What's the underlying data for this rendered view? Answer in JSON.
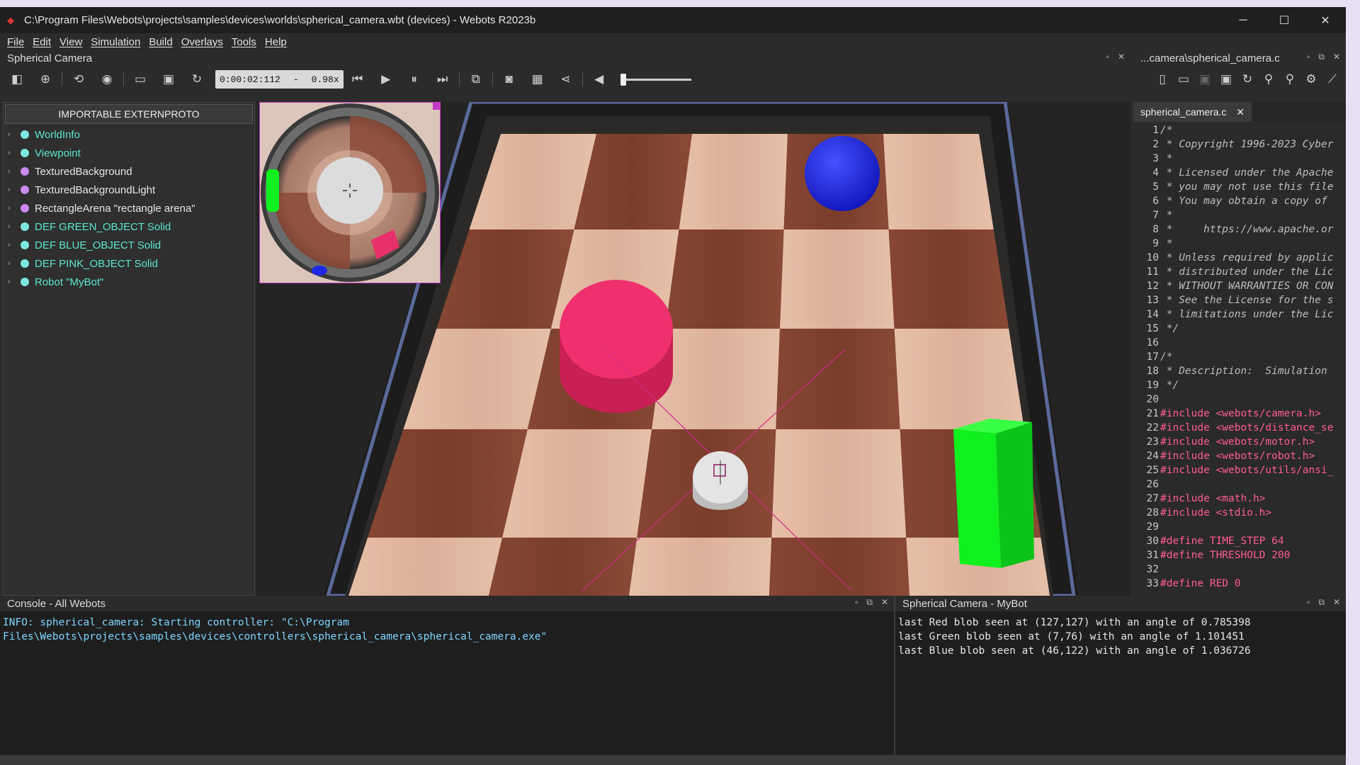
{
  "window": {
    "title": "C:\\Program Files\\Webots\\projects\\samples\\devices\\worlds\\spherical_camera.wbt (devices) - Webots R2023b",
    "minimize": "─",
    "maximize": "☐",
    "close": "✕"
  },
  "menu": [
    "File",
    "Edit",
    "View",
    "Simulation",
    "Build",
    "Overlays",
    "Tools",
    "Help"
  ],
  "scene_panel": {
    "title": "Spherical Camera",
    "time": "0:00:02:112",
    "speed_sep": "-",
    "speed": "0.98x",
    "extern_button": "IMPORTABLE EXTERNPROTO",
    "tree": [
      {
        "label": "WorldInfo",
        "color": "#5ce6d0",
        "dot": "#7ee8e0"
      },
      {
        "label": "Viewpoint",
        "color": "#5ce6d0",
        "dot": "#7ee8e0"
      },
      {
        "label": "TexturedBackground",
        "color": "#e6e6e6",
        "dot": "#c98bf0"
      },
      {
        "label": "TexturedBackgroundLight",
        "color": "#e6e6e6",
        "dot": "#c98bf0"
      },
      {
        "label": "RectangleArena \"rectangle arena\"",
        "color": "#e6e6e6",
        "dot": "#c98bf0"
      },
      {
        "label": "DEF GREEN_OBJECT Solid",
        "color": "#5ce6d0",
        "dot": "#7ee8e0"
      },
      {
        "label": "DEF BLUE_OBJECT Solid",
        "color": "#5ce6d0",
        "dot": "#7ee8e0"
      },
      {
        "label": "DEF PINK_OBJECT Solid",
        "color": "#5ce6d0",
        "dot": "#7ee8e0"
      },
      {
        "label": "Robot \"MyBot\"",
        "color": "#5ce6d0",
        "dot": "#7ee8e0"
      }
    ]
  },
  "editor": {
    "title": "...camera\\spherical_camera.c",
    "tab": "spherical_camera.c",
    "tab_close": "✕",
    "lines": [
      {
        "n": "1",
        "t": "/*",
        "k": "cm"
      },
      {
        "n": "2",
        "t": " * Copyright 1996-2023 Cyber",
        "k": "cm"
      },
      {
        "n": "3",
        "t": " *",
        "k": "cm"
      },
      {
        "n": "4",
        "t": " * Licensed under the Apache",
        "k": "cm"
      },
      {
        "n": "5",
        "t": " * you may not use this file",
        "k": "cm"
      },
      {
        "n": "6",
        "t": " * You may obtain a copy of",
        "k": "cm"
      },
      {
        "n": "7",
        "t": " *",
        "k": "cm"
      },
      {
        "n": "8",
        "t": " *     https://www.apache.or",
        "k": "cm"
      },
      {
        "n": "9",
        "t": " *",
        "k": "cm"
      },
      {
        "n": "10",
        "t": " * Unless required by applic",
        "k": "cm"
      },
      {
        "n": "11",
        "t": " * distributed under the Lic",
        "k": "cm"
      },
      {
        "n": "12",
        "t": " * WITHOUT WARRANTIES OR CON",
        "k": "cm"
      },
      {
        "n": "13",
        "t": " * See the License for the s",
        "k": "cm"
      },
      {
        "n": "14",
        "t": " * limitations under the Lic",
        "k": "cm"
      },
      {
        "n": "15",
        "t": " */",
        "k": "cm"
      },
      {
        "n": "16",
        "t": "",
        "k": "cm"
      },
      {
        "n": "17",
        "t": "/*",
        "k": "cm"
      },
      {
        "n": "18",
        "t": " * Description:  Simulation",
        "k": "cm"
      },
      {
        "n": "19",
        "t": " */",
        "k": "cm"
      },
      {
        "n": "20",
        "t": "",
        "k": "cm"
      },
      {
        "n": "21",
        "t": "#include <webots/camera.h>",
        "k": "pp"
      },
      {
        "n": "22",
        "t": "#include <webots/distance_se",
        "k": "pp"
      },
      {
        "n": "23",
        "t": "#include <webots/motor.h>",
        "k": "pp"
      },
      {
        "n": "24",
        "t": "#include <webots/robot.h>",
        "k": "pp"
      },
      {
        "n": "25",
        "t": "#include <webots/utils/ansi_",
        "k": "pp"
      },
      {
        "n": "26",
        "t": "",
        "k": "pp"
      },
      {
        "n": "27",
        "t": "#include <math.h>",
        "k": "pp"
      },
      {
        "n": "28",
        "t": "#include <stdio.h>",
        "k": "pp"
      },
      {
        "n": "29",
        "t": "",
        "k": "pp"
      },
      {
        "n": "30",
        "t": "#define TIME_STEP 64",
        "k": "pp"
      },
      {
        "n": "31",
        "t": "#define THRESHOLD 200",
        "k": "pp"
      },
      {
        "n": "32",
        "t": "",
        "k": "pp"
      },
      {
        "n": "33",
        "t": "#define RED 0",
        "k": "pp"
      }
    ]
  },
  "console_all": {
    "title": "Console - All Webots",
    "lines": [
      "INFO: spherical_camera: Starting controller: \"C:\\Program",
      "Files\\Webots\\projects\\samples\\devices\\controllers\\spherical_camera\\spherical_camera.exe\""
    ]
  },
  "console_bot": {
    "title": "Spherical Camera - MyBot",
    "lines": [
      "last Red blob seen at (127,127) with an angle of 0.785398",
      "last Green blob seen at (7,76) with an angle of 1.101451",
      "last Blue blob seen at (46,122) with an angle of 1.036726"
    ]
  },
  "colors": {
    "info_text": "#7fd6ff",
    "pink": "#f0306e",
    "blue": "#1e28e6",
    "green": "#10f01e"
  }
}
